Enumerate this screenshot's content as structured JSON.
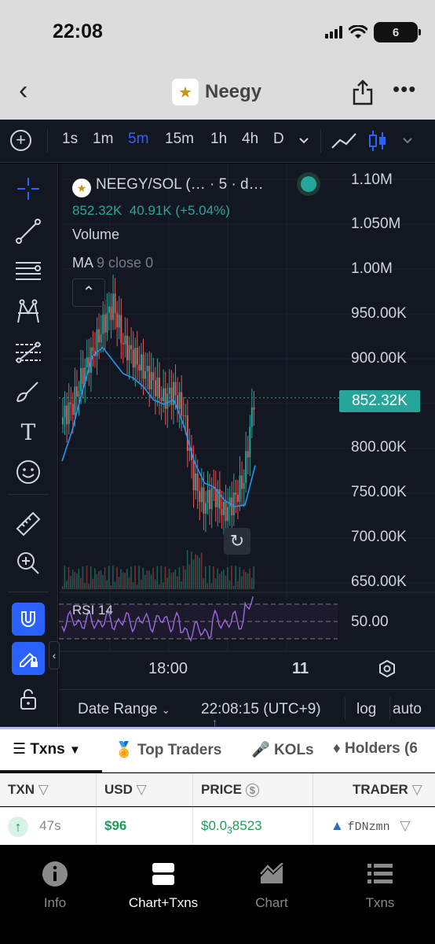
{
  "status_bar": {
    "time": "22:08",
    "battery": "6"
  },
  "nav": {
    "title": "Neegy"
  },
  "toolbar": {
    "intervals": [
      "1s",
      "1m",
      "5m",
      "15m",
      "1h",
      "4h",
      "D"
    ],
    "active_interval": "5m"
  },
  "legend": {
    "symbol": "NEEGY/SOL (… · 5 · d…",
    "close": "852.32K",
    "change": "40.91K (+5.04%)",
    "volume": "Volume",
    "ma_name": "MA",
    "ma_params": "9 close 0"
  },
  "y_axis_labels": [
    "1.10M",
    "1.050M",
    "1.00M",
    "950.00K",
    "900.00K",
    "800.00K",
    "750.00K",
    "700.00K",
    "650.00K"
  ],
  "current_price_tag": "852.32K",
  "rsi": {
    "label": "RSI 14",
    "axis_value": "50.00"
  },
  "time_axis": [
    "18:00",
    "11"
  ],
  "date_bar": {
    "date_range": "Date Range",
    "clock": "22:08:15 (UTC+9)",
    "log": "log",
    "auto": "auto"
  },
  "tabs": [
    "Txns",
    "Top Traders",
    "KOLs",
    "Holders (6"
  ],
  "table": {
    "headers": [
      "TXN",
      "USD",
      "PRICE",
      "TRADER"
    ],
    "rows": [
      {
        "age": "47s",
        "usd": "$96",
        "price_prefix": "$0.0",
        "price_sub": "3",
        "price_rest": "8523",
        "trader": "fDNzmn"
      }
    ]
  },
  "bottom_nav": [
    "Info",
    "Chart+Txns",
    "Chart",
    "Txns"
  ],
  "colors": {
    "up": "#26a69a",
    "down": "#ef5350",
    "ma": "#2196f3",
    "rsi": "#9c6ade",
    "accent": "#2962ff"
  },
  "chart_data": {
    "type": "candlestick",
    "symbol": "NEEGY/SOL",
    "interval": "5",
    "close": [
      830000,
      845000,
      880000,
      905000,
      935000,
      960000,
      915000,
      900000,
      885000,
      870000,
      850000,
      860000,
      835000,
      760000,
      730000,
      745000,
      720000,
      735000,
      760000,
      852320
    ],
    "ma9": [
      780000,
      815000,
      860000,
      900000,
      910000,
      895000,
      880000,
      875000,
      865000,
      850000,
      845000,
      850000,
      820000,
      780000,
      755000,
      750000,
      735000,
      728000,
      730000,
      775000
    ],
    "ylim": [
      630000,
      1120000
    ],
    "current_price": 852320
  }
}
